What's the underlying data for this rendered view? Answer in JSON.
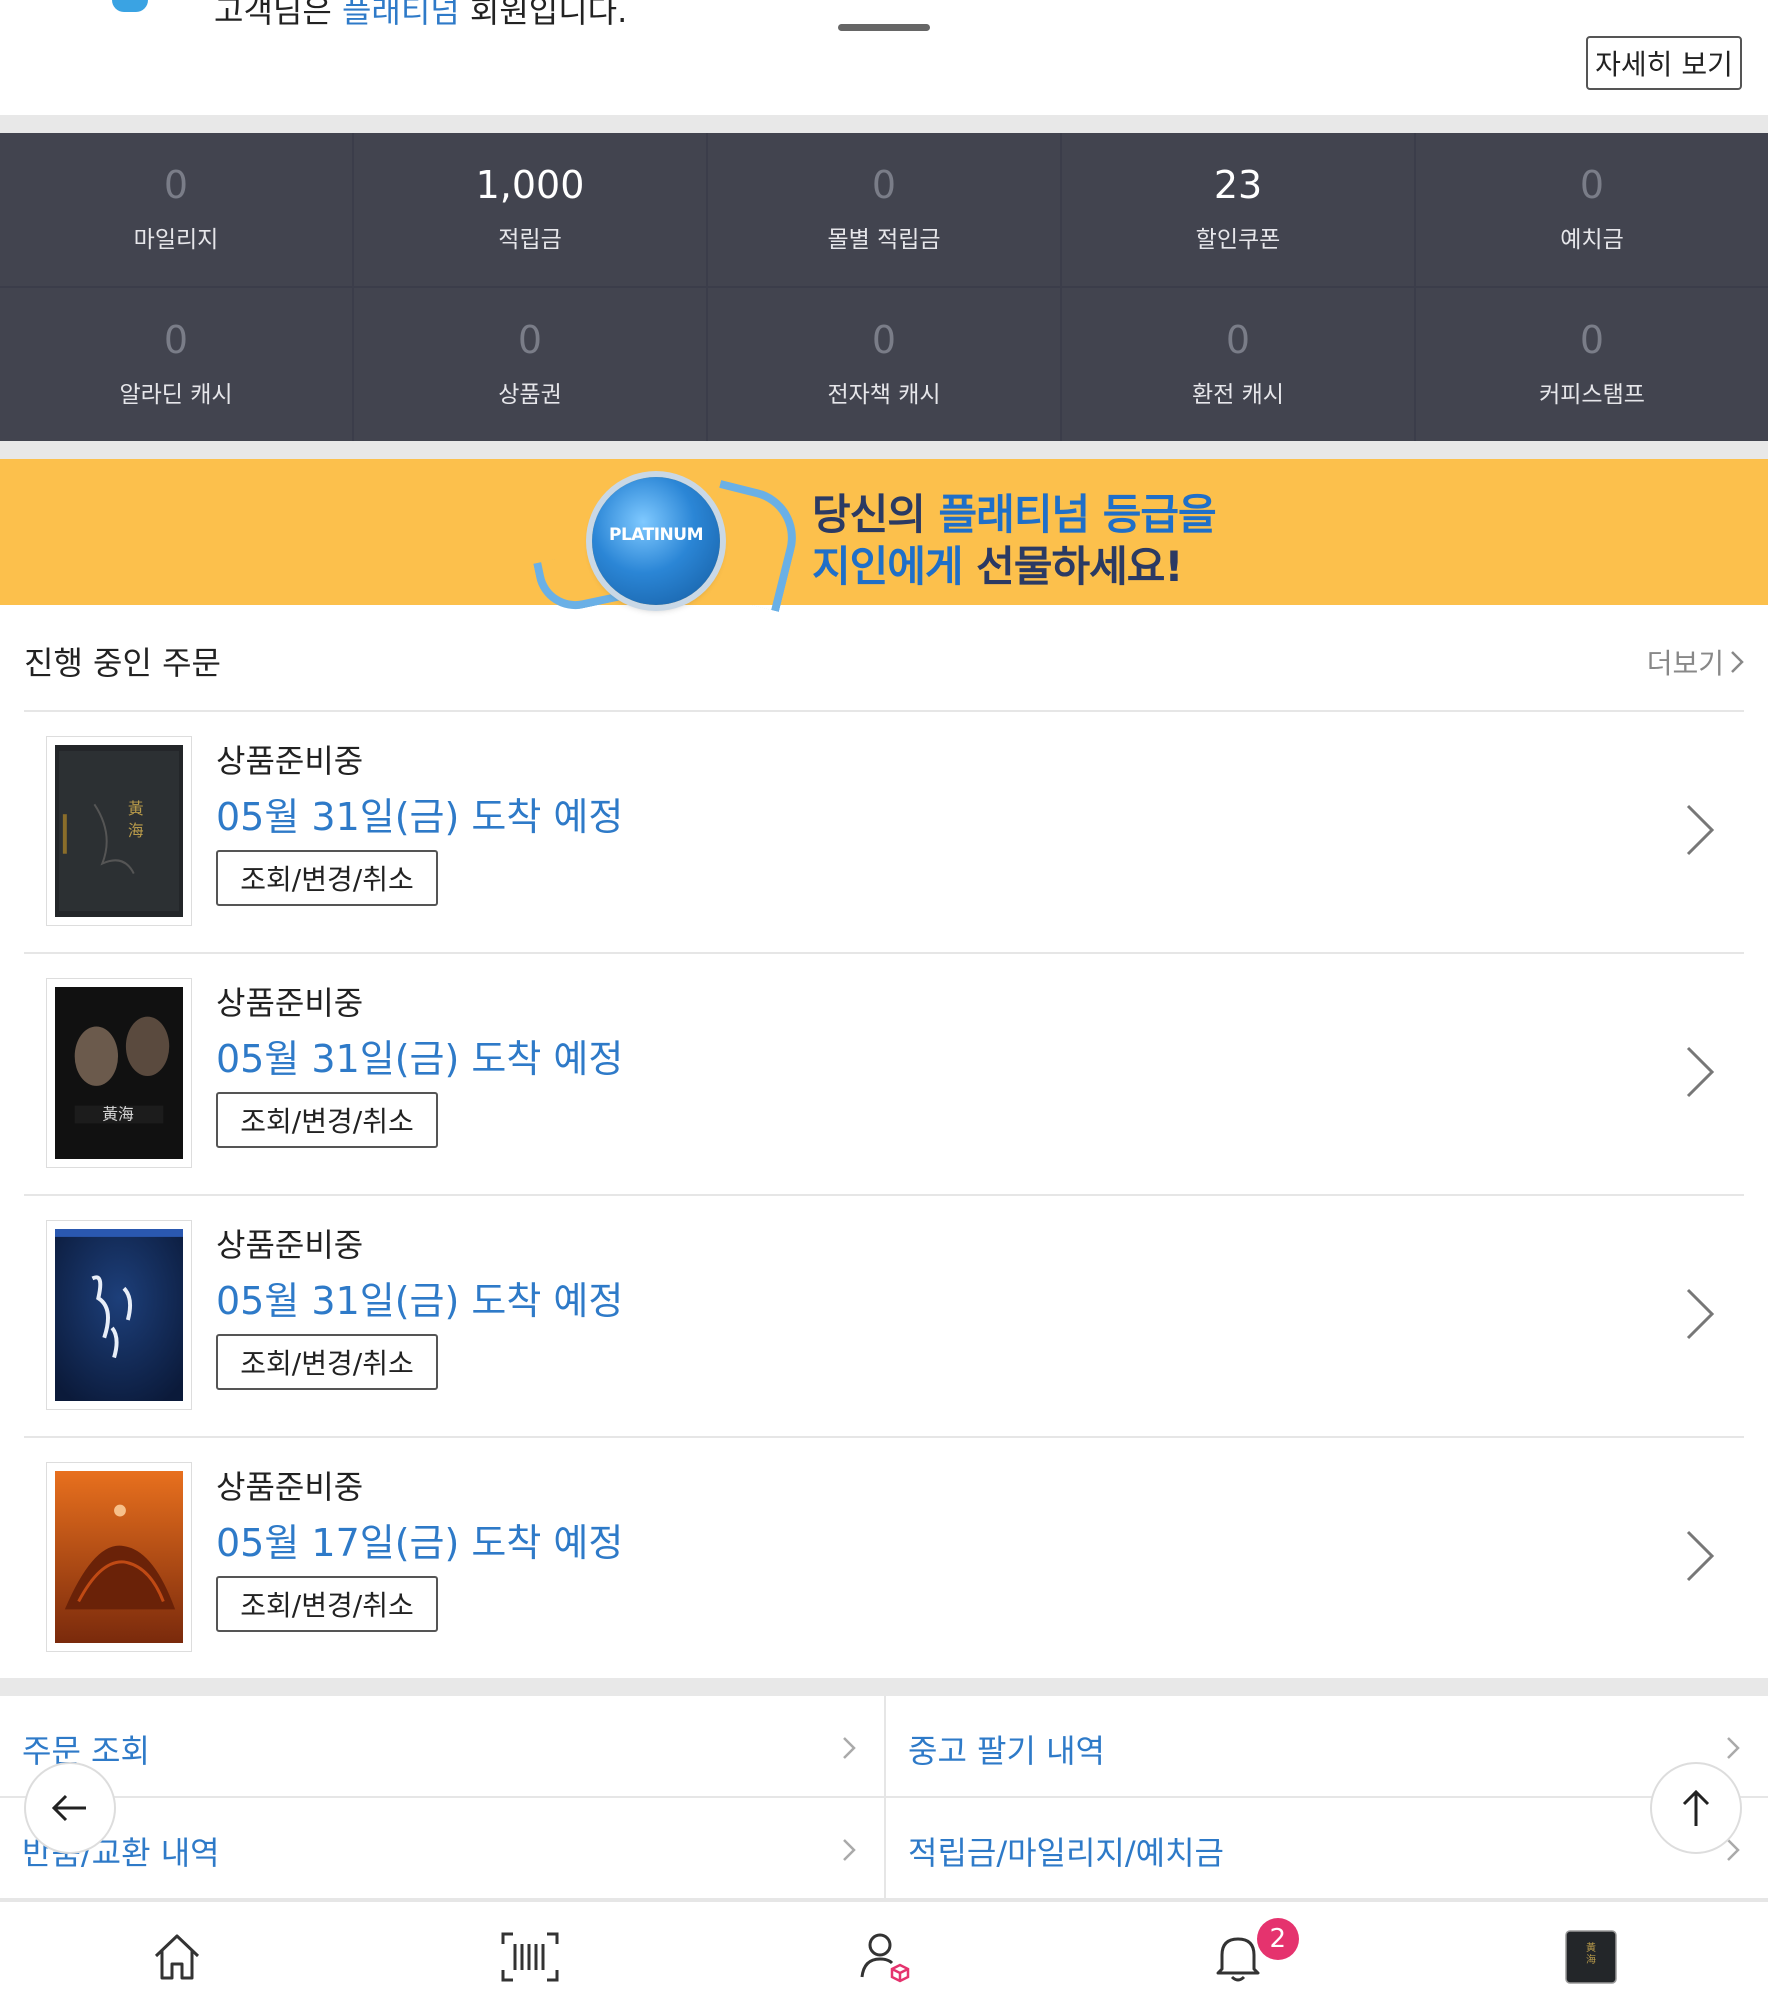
{
  "header": {
    "member_prefix": "고객님은 ",
    "member_grade": "플래티넘",
    "member_suffix": " 회원입니다.",
    "detail_button": "자세히 보기"
  },
  "points": [
    {
      "value": "0",
      "label": "마일리지",
      "highlight": false
    },
    {
      "value": "1,000",
      "label": "적립금",
      "highlight": true
    },
    {
      "value": "0",
      "label": "몰별 적립금",
      "highlight": false
    },
    {
      "value": "23",
      "label": "할인쿠폰",
      "highlight": true
    },
    {
      "value": "0",
      "label": "예치금",
      "highlight": false
    },
    {
      "value": "0",
      "label": "알라딘 캐시",
      "highlight": false
    },
    {
      "value": "0",
      "label": "상품권",
      "highlight": false
    },
    {
      "value": "0",
      "label": "전자책 캐시",
      "highlight": false
    },
    {
      "value": "0",
      "label": "환전 캐시",
      "highlight": false
    },
    {
      "value": "0",
      "label": "커피스탬프",
      "highlight": false
    }
  ],
  "banner": {
    "medal_text": "PLATINUM",
    "line1_prefix": "당신의 ",
    "line1_highlight": "플래티넘 등급을",
    "line2_highlight": "지인에게",
    "line2_suffix": " 선물하세요!"
  },
  "orders_section": {
    "title": "진행 중인 주문",
    "more": "더보기"
  },
  "orders": [
    {
      "status": "상품준비중",
      "arrival": "05월 31일(금) 도착 예정",
      "action": "조회/변경/취소"
    },
    {
      "status": "상품준비중",
      "arrival": "05월 31일(금) 도착 예정",
      "action": "조회/변경/취소"
    },
    {
      "status": "상품준비중",
      "arrival": "05월 31일(금) 도착 예정",
      "action": "조회/변경/취소"
    },
    {
      "status": "상품준비중",
      "arrival": "05월 17일(금) 도착 예정",
      "action": "조회/변경/취소"
    }
  ],
  "links": [
    {
      "label": "주문 조회"
    },
    {
      "label": "중고 팔기 내역"
    },
    {
      "label": "반품/교환 내역"
    },
    {
      "label": "적립금/마일리지/예치금"
    }
  ],
  "nav": {
    "notification_count": "2"
  },
  "colors": {
    "accent_blue": "#2e7ac8",
    "points_bg": "#42444f",
    "banner_bg": "#fcc04c",
    "badge": "#e5336e"
  }
}
